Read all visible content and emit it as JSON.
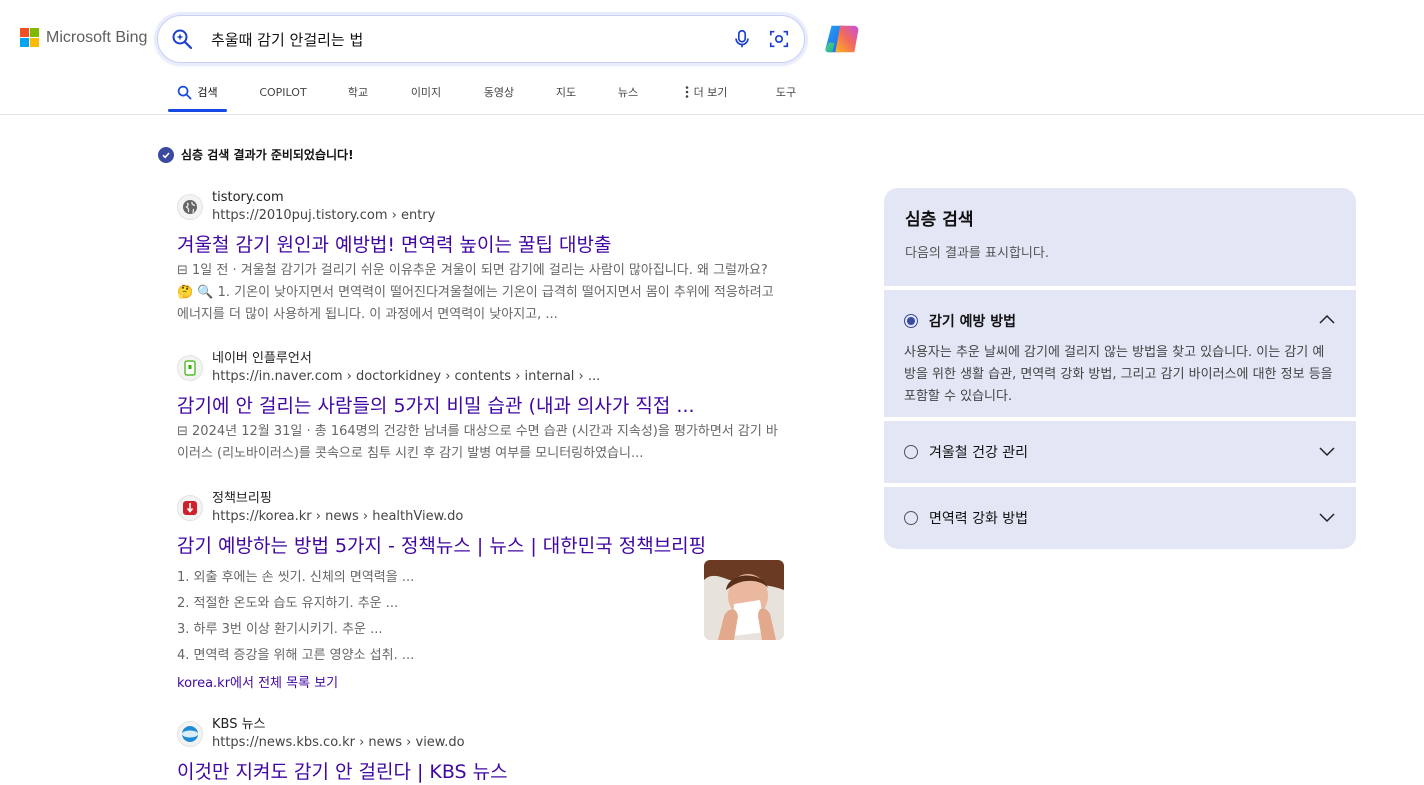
{
  "brand": {
    "name": "Microsoft Bing"
  },
  "search": {
    "query": "추울때 감기 안걸리는 법"
  },
  "tabs": [
    {
      "label": "검색",
      "active": true
    },
    {
      "label": "COPILOT"
    },
    {
      "label": "학교"
    },
    {
      "label": "이미지"
    },
    {
      "label": "동영상"
    },
    {
      "label": "지도"
    },
    {
      "label": "뉴스"
    },
    {
      "label": "더 보기"
    },
    {
      "label": "도구"
    }
  ],
  "status": {
    "text": "심층 검색 결과가 준비되었습니다!"
  },
  "results": [
    {
      "site": "tistory.com",
      "url": "https://2010puj.tistory.com › entry",
      "title": " 겨울철 감기 원인과 예방법! 면역력 높이는 꿀팁 대방출",
      "date": "1일 전 ·",
      "snippet": "겨울철 감기가 걸리기 쉬운 이유추운 겨울이 되면 감기에 걸리는 사람이 많아집니다. 왜 그럴까요? 🤔 🔍 1. 기온이 낮아지면서 면역력이 떨어진다겨울철에는 기온이 급격히 떨어지면서 몸이 추위에 적응하려고 에너지를 더 많이 사용하게 됩니다. 이 과정에서 면역력이 낮아지고, ..."
    },
    {
      "site": "네이버 인플루언서",
      "url": "https://in.naver.com › doctorkidney › contents › internal › ...",
      "title": "감기에 안 걸리는 사람들의 5가지 비밀 습관 (내과 의사가 직접 ...",
      "date": "2024년 12월 31일 ·",
      "snippet": "총 164명의 건강한 남녀를 대상으로 수면 습관 (시간과 지속성)을 평가하면서 감기 바이러스 (리노바이러스)를 콧속으로 침투 시킨 후 감기 발병 여부를 모니터링하였습니..."
    },
    {
      "site": "정책브리핑",
      "url": "https://korea.kr › news › healthView.do",
      "title": "감기 예방하는 방법 5가지 - 정책뉴스 | 뉴스 | 대한민국 정책브리핑",
      "list": [
        "1. 외출 후에는 손 씻기. 신체의 면역력을 ...",
        "2. 적절한 온도와 습도 유지하기. 추운 ...",
        "3. 하루 3번 이상 환기시키기. 추운 ...",
        "4. 면역력 증강을 위해 고른 영양소 섭취. ..."
      ],
      "more": "korea.kr에서 전체 목록 보기"
    },
    {
      "site": "KBS 뉴스",
      "url": "https://news.kbs.co.kr › news › view.do",
      "title": "이것만 지켜도 감기 안 걸린다 | KBS 뉴스"
    }
  ],
  "panel": {
    "title": "심층 검색",
    "subtitle": "다음의 결과를 표시합니다.",
    "sections": [
      {
        "label": "감기 예방 방법",
        "selected": true,
        "expanded": true,
        "body": "사용자는 추운 날씨에 감기에 걸리지 않는 방법을 찾고 있습니다. 이는 감기 예방을 위한 생활 습관, 면역력 강화 방법, 그리고 감기 바이러스에 대한 정보 등을 포함할 수 있습니다."
      },
      {
        "label": "겨울철 건강 관리",
        "selected": false,
        "expanded": false
      },
      {
        "label": "면역력 강화 방법",
        "selected": false,
        "expanded": false
      }
    ]
  },
  "colors": {
    "accent": "#174ae4",
    "link": "#4007a2",
    "panel_bg": "#e3e6f5"
  }
}
